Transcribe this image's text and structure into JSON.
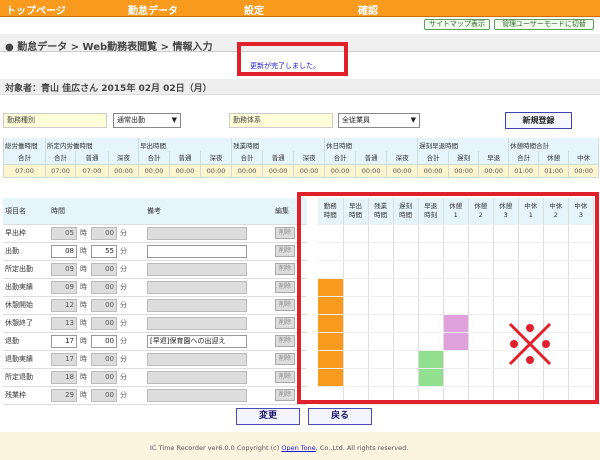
{
  "nav": {
    "items": [
      "トップページ",
      "勤怠データ",
      "設定",
      "確認"
    ]
  },
  "header_buttons": {
    "sitemap": "サイトマップ表示",
    "admin": "管理ユーザーモードに切替"
  },
  "breadcrumb": "● 勤怠データ > Web勤務表閲覧 > 情報入力",
  "message": "更新が完了しました。",
  "target": "対象者：青山 佳広さん 2015年 02月 02日（月）",
  "form": {
    "kinmu_shubetsu_label": "勤務種別",
    "kinmu_shubetsu_value": "通常出勤",
    "kinmu_taikei_label": "勤務体系",
    "kinmu_taikei_value": "全従業員",
    "new_button": "新規登録",
    "arrow": "▼"
  },
  "summary": {
    "groups": [
      "総労働時間",
      "所定内労働時間",
      "早出時間",
      "残業時間",
      "休日時間",
      "遅刻早退時間",
      "休憩時間合計"
    ],
    "sub": [
      "合計",
      "合計",
      "普通",
      "深夜",
      "合計",
      "普通",
      "深夜",
      "合計",
      "普通",
      "深夜",
      "合計",
      "普通",
      "深夜",
      "合計",
      "遅刻",
      "早退",
      "合計",
      "休憩",
      "中休"
    ],
    "values": [
      "07:00",
      "07:00",
      "07:00",
      "00:00",
      "00:00",
      "00:00",
      "00:00",
      "00:00",
      "00:00",
      "00:00",
      "00:00",
      "00:00",
      "00:00",
      "00:00",
      "00:00",
      "00:00",
      "01:00",
      "01:00",
      "00:00"
    ]
  },
  "detail": {
    "headers": {
      "item": "項目名",
      "time": "時間",
      "note": "備考",
      "edit": "編集"
    },
    "hour_unit": "時",
    "minute_unit": "分",
    "delete_label": "削除",
    "rows": [
      {
        "name": "早出枠",
        "h": "05",
        "m": "00",
        "note": ""
      },
      {
        "name": "出勤",
        "h": "08",
        "m": "55",
        "note": ""
      },
      {
        "name": "所定出勤",
        "h": "09",
        "m": "00",
        "note": ""
      },
      {
        "name": "出勤実績",
        "h": "09",
        "m": "00",
        "note": ""
      },
      {
        "name": "休憩開始",
        "h": "12",
        "m": "00",
        "note": ""
      },
      {
        "name": "休憩終了",
        "h": "13",
        "m": "00",
        "note": ""
      },
      {
        "name": "退勤",
        "h": "17",
        "m": "00",
        "note": "[早退]保育園への出迎え"
      },
      {
        "name": "退勤実績",
        "h": "17",
        "m": "00",
        "note": ""
      },
      {
        "name": "所定退勤",
        "h": "18",
        "m": "00",
        "note": ""
      },
      {
        "name": "残業枠",
        "h": "29",
        "m": "00",
        "note": ""
      }
    ]
  },
  "grid": {
    "headers": [
      [
        "勤務",
        "時間"
      ],
      [
        "早出",
        "時間"
      ],
      [
        "残業",
        "時間"
      ],
      [
        "遅刻",
        "時間"
      ],
      [
        "早退",
        "時刻"
      ],
      [
        "休憩",
        "1"
      ],
      [
        "休憩",
        "2"
      ],
      [
        "休憩",
        "3"
      ],
      [
        "中休",
        "1"
      ],
      [
        "中休",
        "2"
      ],
      [
        "中休",
        "3"
      ]
    ],
    "colors": {
      "work": "#f79a1e",
      "break": "#dfa0db",
      "early_leave": "#90e090"
    }
  },
  "buttons": {
    "change": "変更",
    "back": "戻る"
  },
  "footer": {
    "prefix": "IC Time Recorder ver6.0.0 Copyright (c) ",
    "link": "Open Tone",
    "suffix": ", Co.,Ltd. All rights reserved."
  }
}
